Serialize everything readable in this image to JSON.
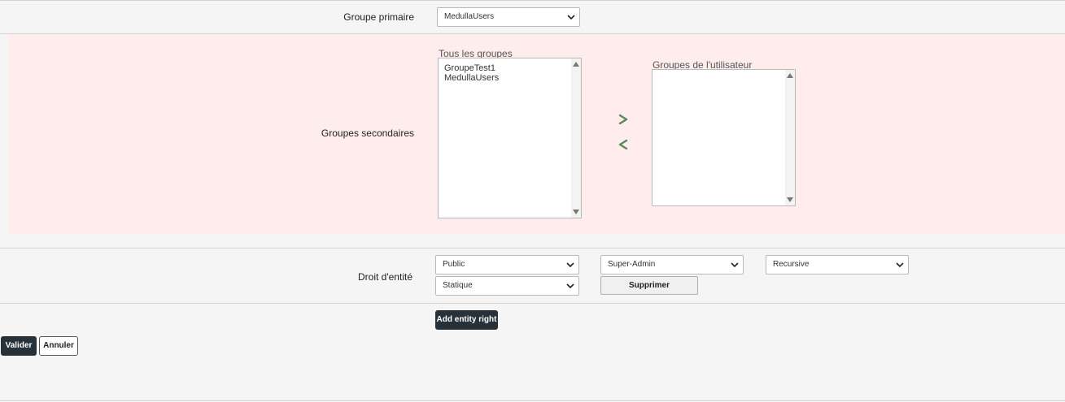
{
  "primary_group": {
    "label": "Groupe primaire",
    "selected": "MedullaUsers"
  },
  "secondary_groups": {
    "label": "Groupes secondaires",
    "all_groups_caption": "Tous les groupes",
    "all_groups": [
      "GroupeTest1",
      "MedullaUsers"
    ],
    "user_groups_caption": "Groupes de l'utilisateur",
    "user_groups": [],
    "add_arrow_icon": "chevron-right-icon",
    "remove_arrow_icon": "chevron-left-icon",
    "arrow_color": "#5a8a5a"
  },
  "entity_right": {
    "label": "Droit d'entité",
    "entity_select": "Public",
    "profile_select": "Super-Admin",
    "recursive_select": "Recursive",
    "type_select": "Statique",
    "delete_label": "Supprimer",
    "add_label": "Add entity right"
  },
  "actions": {
    "validate_label": "Valider",
    "cancel_label": "Annuler"
  },
  "colors": {
    "pink_section": "#ffecec",
    "dark_button": "#27313a"
  }
}
